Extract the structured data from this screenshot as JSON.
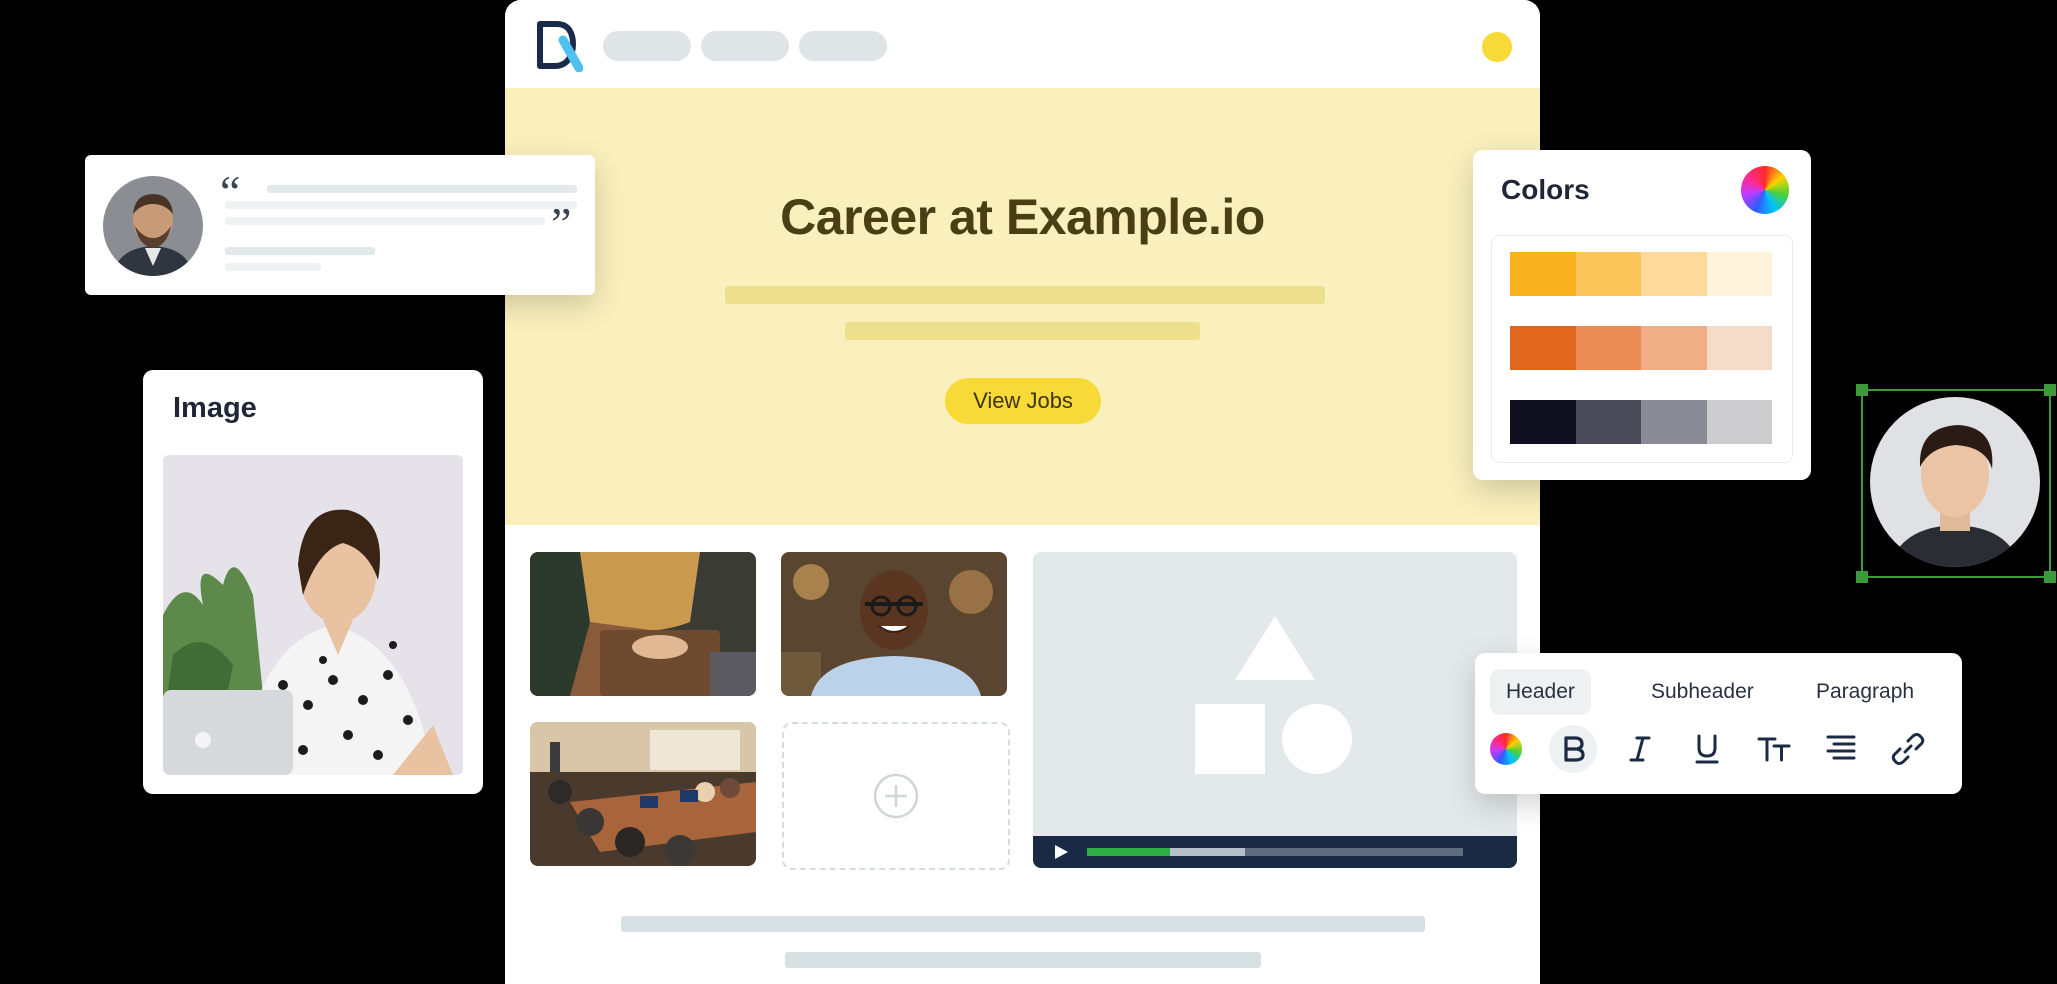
{
  "hero": {
    "title": "Career at Example.io",
    "cta_label": "View Jobs"
  },
  "image_card": {
    "title": "Image"
  },
  "colors_panel": {
    "title": "Colors",
    "palettes": [
      [
        "#fbb21f",
        "#fdc65a",
        "#fdd99a",
        "#fef4dc"
      ],
      [
        "#e0671c",
        "#ea8b55",
        "#f0ae86",
        "#f4dcc9"
      ],
      [
        "#0f0f1f",
        "#4a4a58",
        "#8a8a96",
        "#cccccf"
      ]
    ]
  },
  "text_toolbar": {
    "tabs": [
      "Header",
      "Subheader",
      "Paragraph"
    ],
    "active_tab": "Header",
    "icons": [
      "color-wheel-icon",
      "bold-icon",
      "italic-icon",
      "underline-icon",
      "text-size-icon",
      "align-right-icon",
      "link-icon"
    ]
  },
  "video_player": {
    "progress": 0.22,
    "buffered": 0.42
  },
  "brand": {
    "accent": "#f7d938",
    "hero_bg": "#faf0bd",
    "selection": "#3c9a3a"
  }
}
